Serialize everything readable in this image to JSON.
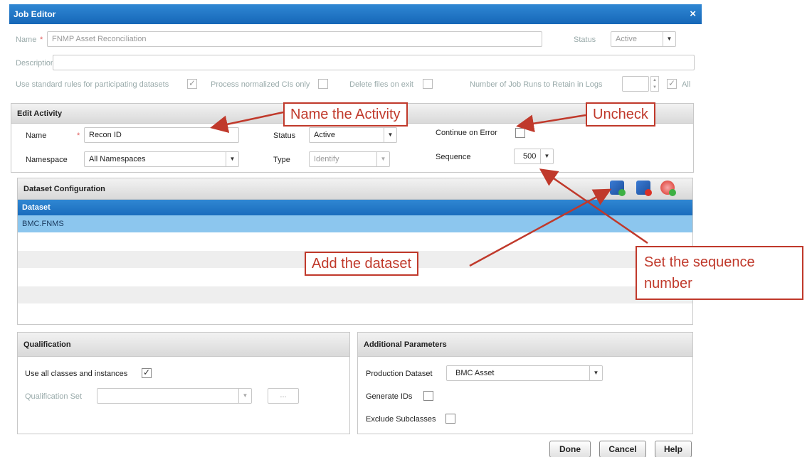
{
  "window": {
    "title": "Job Editor",
    "close": "×"
  },
  "job": {
    "name_label": "Name",
    "required": "*",
    "name_value": "FNMP Asset Reconciliation",
    "status_label": "Status",
    "status_value": "Active",
    "description_label": "Description",
    "standard_rules_label": "Use standard rules for participating datasets",
    "standard_rules_checked": "✓",
    "normalized_label": "Process normalized CIs only",
    "delete_files_label": "Delete files on exit",
    "job_runs_label": "Number of Job Runs to Retain in Logs",
    "all_label": "All",
    "all_checked": "✓"
  },
  "edit_activity": {
    "title": "Edit Activity",
    "name_label": "Name",
    "required": "*",
    "name_value": "Recon ID",
    "namespace_label": "Namespace",
    "namespace_value": "All Namespaces",
    "status_label": "Status",
    "status_value": "Active",
    "type_label": "Type",
    "type_value": "Identify",
    "continue_label": "Continue on Error",
    "sequence_label": "Sequence",
    "sequence_value": "500"
  },
  "dataset_config": {
    "title": "Dataset Configuration",
    "column": "Dataset",
    "rows": [
      "BMC.FNMS",
      "",
      "",
      "",
      "",
      "",
      ""
    ]
  },
  "qualification": {
    "title": "Qualification",
    "use_all_label": "Use all classes and instances",
    "use_all_checked": "✓",
    "set_label": "Qualification Set",
    "browse": "..."
  },
  "additional": {
    "title": "Additional Parameters",
    "production_label": "Production Dataset",
    "production_value": "BMC Asset",
    "generate_label": "Generate IDs",
    "exclude_label": "Exclude Subclasses"
  },
  "buttons": {
    "done": "Done",
    "cancel": "Cancel",
    "help": "Help"
  },
  "callouts": {
    "name_activity": "Name the Activity",
    "uncheck": "Uncheck",
    "add_dataset": "Add the dataset",
    "set_sequence_1": "Set the sequence",
    "set_sequence_2": "number"
  },
  "colors": {
    "title_bar": "#1a6cbd",
    "callout": "#c0392b",
    "selected_row": "#8cc6ee"
  }
}
